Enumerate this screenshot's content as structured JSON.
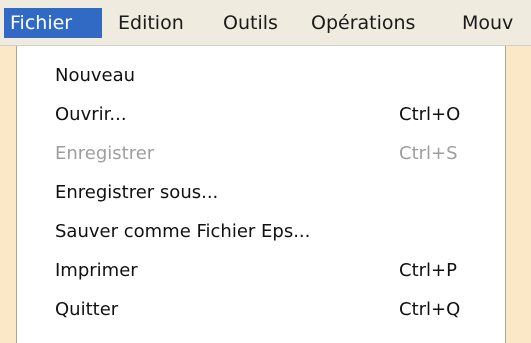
{
  "menubar": {
    "items": [
      {
        "label": "Fichier"
      },
      {
        "label": "Edition"
      },
      {
        "label": "Outils"
      },
      {
        "label": "Opérations"
      },
      {
        "label": "Mouv"
      }
    ]
  },
  "file_menu": {
    "items": [
      {
        "label": "Nouveau",
        "shortcut": ""
      },
      {
        "label": "Ouvrir...",
        "shortcut": "Ctrl+O"
      },
      {
        "label": "Enregistrer",
        "shortcut": "Ctrl+S"
      },
      {
        "label": "Enregistrer sous...",
        "shortcut": ""
      },
      {
        "label": "Sauver comme Fichier Eps...",
        "shortcut": ""
      },
      {
        "label": "Imprimer",
        "shortcut": "Ctrl+P"
      },
      {
        "label": "Quitter",
        "shortcut": "Ctrl+Q"
      }
    ]
  },
  "colors": {
    "menubar_background": "#efebde",
    "selection_highlight": "#316ac5",
    "disabled_text": "#9e9e9e",
    "page_background": "#fbe8c6"
  }
}
